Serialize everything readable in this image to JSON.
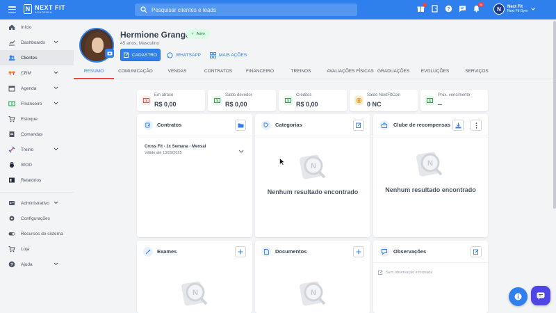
{
  "topbar": {
    "brand_line1": "NEXT FIT",
    "brand_line2": "ACADEMIA",
    "search_placeholder": "Pesquisar clientes e leads",
    "notifications_count": "38",
    "user_initial": "N",
    "user_name": "Next Fit",
    "user_gym": "Next Fit Gym"
  },
  "sidebar": {
    "items": [
      {
        "label": "Início",
        "icon": "home-icon"
      },
      {
        "label": "Dashboards",
        "icon": "chart-icon"
      },
      {
        "label": "Clientes",
        "icon": "users-icon"
      },
      {
        "label": "CRM",
        "icon": "crm-icon"
      },
      {
        "label": "Agenda",
        "icon": "calendar-icon"
      },
      {
        "label": "Financeiro",
        "icon": "money-icon"
      },
      {
        "label": "Estoque",
        "icon": "cart-icon"
      },
      {
        "label": "Comandas",
        "icon": "receipt-icon"
      },
      {
        "label": "Treino",
        "icon": "dumbbell-icon"
      },
      {
        "label": "WOD",
        "icon": "kettlebell-icon"
      },
      {
        "label": "Relatórios",
        "icon": "report-icon"
      },
      {
        "label": "Administrativo",
        "icon": "admin-icon"
      },
      {
        "label": "Configurações",
        "icon": "gear-icon"
      },
      {
        "label": "Recursos do sistema",
        "icon": "toggle-icon"
      },
      {
        "label": "Loja",
        "icon": "store-icon"
      },
      {
        "label": "Ajuda",
        "icon": "help-icon"
      }
    ]
  },
  "client": {
    "name": "Hermione Granger",
    "status": "Ativo",
    "subtitle": "45 anos, Masculino",
    "btn_cadastro": "CADASTRO",
    "btn_whatsapp": "WHATSAPP",
    "btn_more": "MAIS AÇÕES"
  },
  "tabs": [
    "RESUMO",
    "COMUNICAÇÃO",
    "VENDAS",
    "CONTRATOS",
    "FINANCEIRO",
    "TREINOS",
    "AVALIAÇÕES FÍSICAS",
    "GRADUAÇÕES",
    "EVOLUÇÕES",
    "SERVIÇOS"
  ],
  "summary": [
    {
      "label": "Em atraso",
      "value": "R$ 0,00"
    },
    {
      "label": "Saldo devedor",
      "value": "R$ 0,00"
    },
    {
      "label": "Créditos",
      "value": "R$ 0,00"
    },
    {
      "label": "Saldo NextFitCoin",
      "value": "0 NC"
    },
    {
      "label": "Próx. vencimento",
      "value": "--"
    }
  ],
  "panels": {
    "contratos": {
      "title": "Contratos",
      "item_title": "Cross Fit - 1x Semana - Mensal",
      "item_sub": "Válido até 13/09/2025"
    },
    "categorias": {
      "title": "Categorias",
      "empty": "Nenhum resultado encontrado"
    },
    "clube": {
      "title": "Clube de recompensas",
      "empty": "Nenhum resultado encontrado"
    },
    "exames": {
      "title": "Exames"
    },
    "documentos": {
      "title": "Documentos"
    },
    "observacoes": {
      "title": "Observações",
      "empty": "Sem observação informada"
    }
  },
  "colors": {
    "primary": "#2f80ed",
    "danger": "#ef4444",
    "success": "#15803d"
  }
}
